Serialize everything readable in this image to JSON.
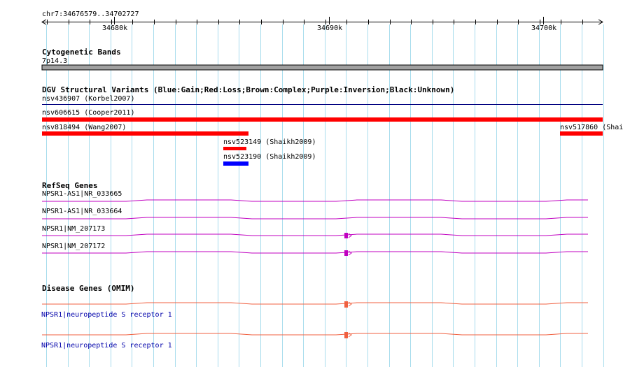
{
  "ruler": {
    "range_label": "chr7:34676579..34702727",
    "ticks": [
      "34680k",
      "34690k",
      "34700k"
    ]
  },
  "cytoband": {
    "title": "Cytogenetic Bands",
    "band": "7p14.3",
    "color": "#a0a0a0"
  },
  "dgv": {
    "title": "DGV Structural Variants (Blue:Gain;Red:Loss;Brown:Complex;Purple:Inversion;Black:Unknown)",
    "variants": [
      {
        "id": "nsv436907",
        "study": "(Korbel2007)",
        "color": "#000080"
      },
      {
        "id": "nsv606615",
        "study": "(Cooper2011)",
        "color": "#ff0000"
      },
      {
        "id": "nsv818494",
        "study": "(Wang2007)",
        "color": "#ff0000"
      },
      {
        "id": "nsv517860",
        "study": "(Shai",
        "color": "#ff0000"
      },
      {
        "id": "nsv523149",
        "study": "(Shaikh2009)",
        "color": "#ff0000"
      },
      {
        "id": "nsv523190",
        "study": "(Shaikh2009)",
        "color": "#0000ff"
      }
    ]
  },
  "refseq": {
    "title": "RefSeq Genes",
    "color": "#c000c0",
    "genes": [
      {
        "label": "NPSR1-AS1|NR_033665"
      },
      {
        "label": "NPSR1-AS1|NR_033664"
      },
      {
        "label": "NPSR1|NM_207173"
      },
      {
        "label": "NPSR1|NM_207172"
      }
    ]
  },
  "omim": {
    "title": "Disease Genes (OMIM)",
    "color": "#f06040",
    "genes": [
      {
        "label": "NPSR1|neuropeptide S receptor 1"
      },
      {
        "label": "NPSR1|neuropeptide S receptor 1"
      }
    ]
  },
  "grid_color": "#a8dced"
}
